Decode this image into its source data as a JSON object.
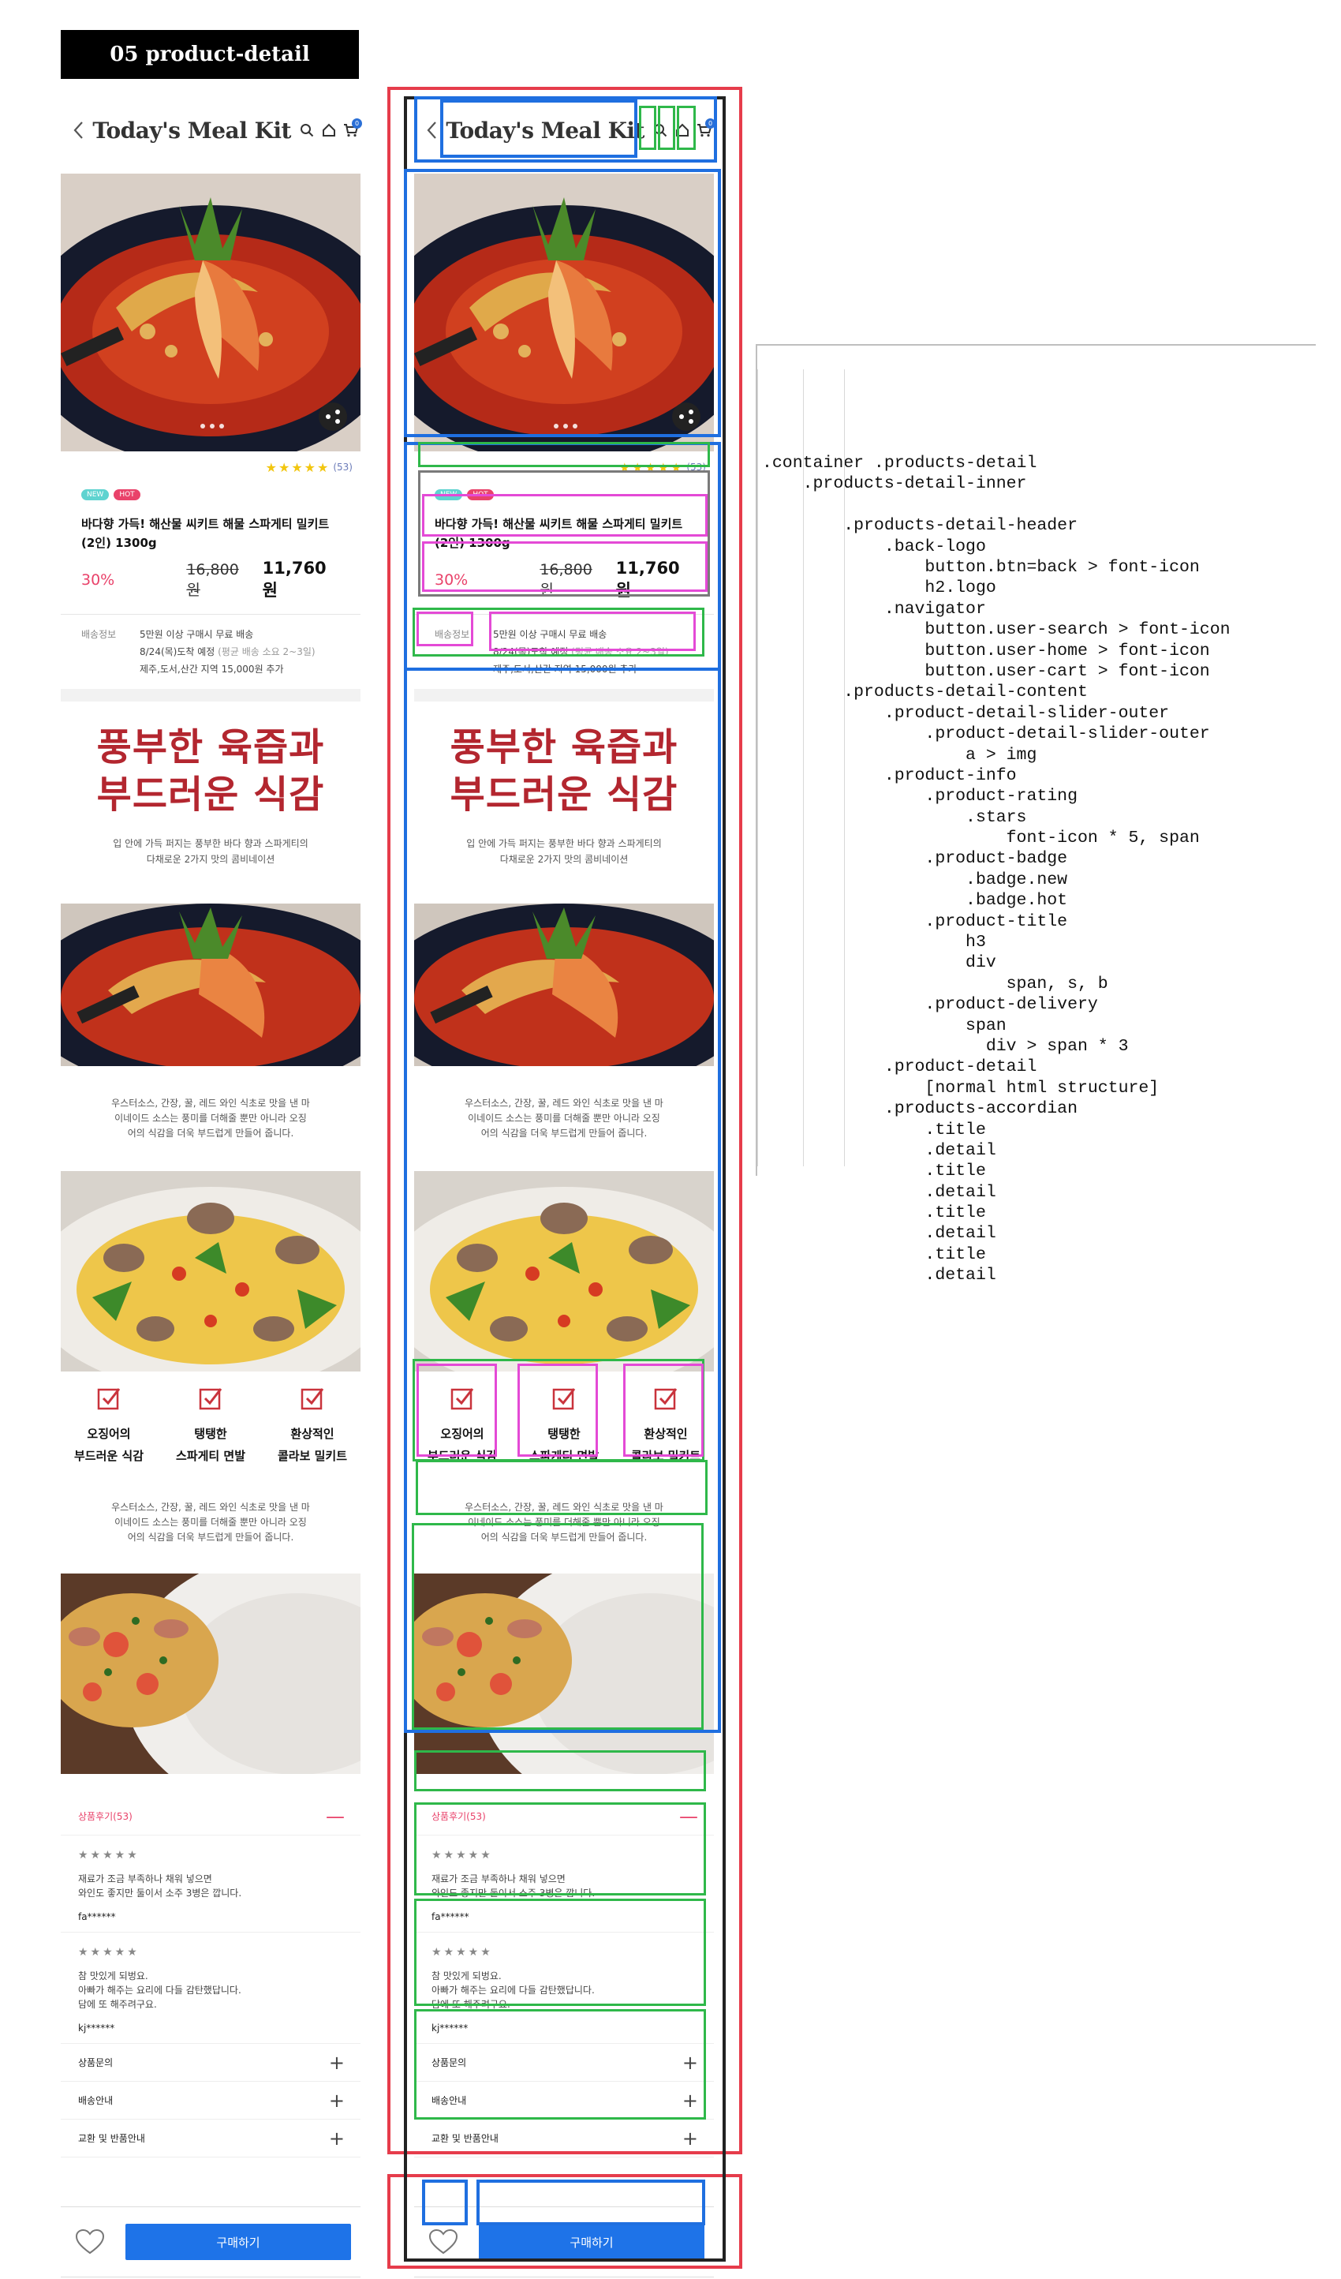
{
  "page_title": "05 product-detail",
  "header": {
    "logo": "Today's Meal Kit",
    "cart_count": "0"
  },
  "product": {
    "rating_count": "(53)",
    "badges": {
      "new": "NEW",
      "hot": "HOT"
    },
    "title": "바다향 가득! 해산물 씨키트 해물 스파게티 밀키트 (2인) 1300g",
    "discount": "30%",
    "original_price": "16,800원",
    "final_price": "11,760원",
    "delivery": {
      "label": "배송정보",
      "line1": "5만원 이상 구매시 무료 배송",
      "line2_main": "8/24(목)도착 예정",
      "line2_note": "(평균 배송 소요 2~3일)",
      "line3": "제주,도서,산간 지역 15,000원 추가"
    }
  },
  "detail": {
    "headline_1": "풍부한 육즙과",
    "headline_2": "부드러운 식감",
    "sub_1": "입 안에 가득 퍼지는 풍부한 바다 향과 스파게티의",
    "sub_2": "다채로운 2가지 맛의 콤비네이션",
    "para_1": "우스터소스, 간장, 꿀, 레드 와인 식초로 맛을 낸 마",
    "para_2": "이네이드 소스는 풍미를 더해줄 뿐만 아니라 오징",
    "para_3": "어의 식감을 더욱 부드럽게 만들어 줍니다.",
    "features": [
      {
        "l1": "오징어의",
        "l2": "부드러운 식감"
      },
      {
        "l1": "탱탱한",
        "l2": "스파게티 면발"
      },
      {
        "l1": "환상적인",
        "l2": "콜라보 밀키트"
      }
    ]
  },
  "accordion": {
    "reviews_title": "상품후기(53)",
    "reviews": [
      {
        "stars": "★★★★★",
        "l1": "재료가 조금 부족하나 채워 넣으면",
        "l2": "와인도 좋지만 둘이서 소주 3병은 깝니다.",
        "l3": "",
        "user": "fa******"
      },
      {
        "stars": "★★★★★",
        "l1": "참 맛있게 되벙요.",
        "l2": "아빠가 해주는 요리에 다들 감탄했답니다.",
        "l3": "담에 또 해주려구요.",
        "user": "kj******"
      }
    ],
    "qna_title": "상품문의",
    "shipping_title": "배송안내",
    "return_title": "교환 및 반품안내"
  },
  "bottom": {
    "buy_label": "구매하기"
  },
  "code_lines": [
    ".container .products-detail",
    "    .products-detail-inner",
    "",
    "        .products-detail-header",
    "            .back-logo",
    "                button.btn=back > font-icon",
    "                h2.logo",
    "            .navigator",
    "                button.user-search > font-icon",
    "                button.user-home > font-icon",
    "                button.user-cart > font-icon",
    "        .products-detail-content",
    "            .product-detail-slider-outer",
    "                .product-detail-slider-outer",
    "                    a > img",
    "            .product-info",
    "                .product-rating",
    "                    .stars",
    "                        font-icon * 5, span",
    "                .product-badge",
    "                    .badge.new",
    "                    .badge.hot",
    "                .product-title",
    "                    h3",
    "                    div",
    "                        span, s, b",
    "                .product-delivery",
    "                    span",
    "                      div > span * 3",
    "            .product-detail",
    "                [normal html structure]",
    "            .products-accordian",
    "                .title",
    "                .detail",
    "                .title",
    "                .detail",
    "                .title",
    "                .detail",
    "                .title",
    "                .detail"
  ],
  "colors": {
    "accent": "#e9426a",
    "primary": "#1e73e8",
    "headline": "#b3262f",
    "star": "#f2c60f"
  }
}
